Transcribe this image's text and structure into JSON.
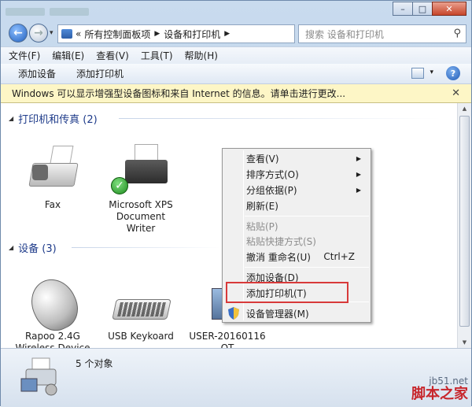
{
  "window": {
    "title_buttons": {
      "minimize": "–",
      "maximize": "□",
      "close": "✕"
    }
  },
  "address_bar": {
    "crumbs": [
      "所有控制面板项",
      "设备和打印机"
    ],
    "overflow": "«"
  },
  "search": {
    "placeholder": "搜索 设备和打印机"
  },
  "menu": [
    "文件(F)",
    "编辑(E)",
    "查看(V)",
    "工具(T)",
    "帮助(H)"
  ],
  "toolbar": {
    "add_device": "添加设备",
    "add_printer": "添加打印机"
  },
  "info_bar": {
    "text": "Windows 可以显示增强型设备图标和来自 Internet 的信息。请单击进行更改..."
  },
  "groups": {
    "printers": {
      "title": "打印机和传真 (2)"
    },
    "devices": {
      "title": "设备 (3)"
    }
  },
  "printers": [
    {
      "name": "Fax",
      "icon": "fax-icon"
    },
    {
      "name": "Microsoft XPS Document Writer",
      "icon": "printer-icon",
      "default": true
    }
  ],
  "devices": [
    {
      "name": "Rapoo 2.4G Wireless Device",
      "icon": "mouse-icon"
    },
    {
      "name": "USB Keykoard",
      "icon": "keyboard-icon"
    },
    {
      "name": "USER-20160116 QT",
      "icon": "computer-icon"
    }
  ],
  "context_menu": {
    "view": "查看(V)",
    "sort": "排序方式(O)",
    "group": "分组依据(P)",
    "refresh": "刷新(E)",
    "paste": "粘贴(P)",
    "paste_shortcut": "粘贴快捷方式(S)",
    "undo": "撤消 重命名(U)",
    "undo_shortcut": "Ctrl+Z",
    "add_device": "添加设备(D)",
    "add_printer": "添加打印机(T)",
    "device_manager": "设备管理器(M)"
  },
  "status": {
    "count": "5 个对象"
  },
  "watermark": {
    "site": "jb51.net",
    "brand": "脚本之家"
  },
  "colors": {
    "highlight_box": "#d83a3a",
    "group_title": "#1e3b8a",
    "info_bar": "#fdf6c6"
  }
}
